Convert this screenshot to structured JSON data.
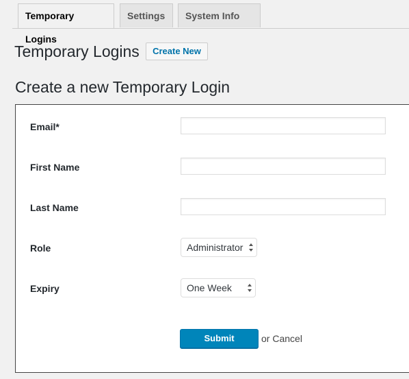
{
  "tabs": [
    {
      "label": "Temporary Logins",
      "active": true
    },
    {
      "label": "Settings",
      "active": false
    },
    {
      "label": "System Info",
      "active": false
    }
  ],
  "header": {
    "title": "Temporary Logins",
    "create_new_label": "Create New"
  },
  "form": {
    "title": "Create a new Temporary Login",
    "fields": {
      "email": {
        "label": "Email*",
        "value": ""
      },
      "first_name": {
        "label": "First Name",
        "value": ""
      },
      "last_name": {
        "label": "Last Name",
        "value": ""
      },
      "role": {
        "label": "Role",
        "selected": "Administrator"
      },
      "expiry": {
        "label": "Expiry",
        "selected": "One Week"
      }
    },
    "submit_label": "Submit",
    "or_text": "or",
    "cancel_label": "Cancel"
  },
  "colors": {
    "primary_button": "#0085ba",
    "link": "#0073aa",
    "background": "#f1f1f1"
  }
}
